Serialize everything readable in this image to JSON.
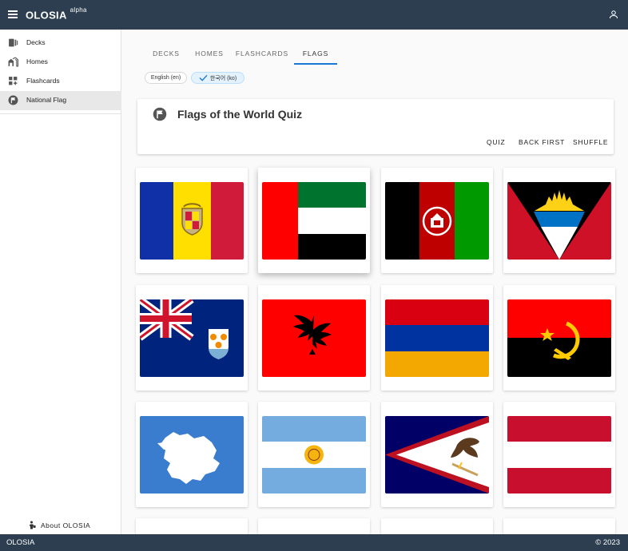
{
  "app": {
    "name": "OLOSIA",
    "stage": "alpha"
  },
  "sidebar": {
    "items": [
      {
        "label": "Decks",
        "icon": "deck-icon"
      },
      {
        "label": "Homes",
        "icon": "homes-icon"
      },
      {
        "label": "Flashcards",
        "icon": "flashcards-icon"
      },
      {
        "label": "National Flag",
        "icon": "flag-icon",
        "active": true
      }
    ],
    "about": "About OLOSIA"
  },
  "tabs": [
    {
      "label": "DECKS"
    },
    {
      "label": "HOMES"
    },
    {
      "label": "FLASHCARDS"
    },
    {
      "label": "FLAGS",
      "active": true
    }
  ],
  "chips": {
    "english": "English (en)",
    "korean": "한국어 (ko)",
    "selected": "korean"
  },
  "quiz": {
    "title": "Flags of the World Quiz",
    "actions": {
      "quiz": "QUIZ",
      "back_first": "BACK FIRST",
      "shuffle": "SHUFFLE"
    }
  },
  "flags": [
    {
      "name": "andorra"
    },
    {
      "name": "united-arab-emirates"
    },
    {
      "name": "afghanistan"
    },
    {
      "name": "antigua-and-barbuda"
    },
    {
      "name": "anguilla"
    },
    {
      "name": "albania"
    },
    {
      "name": "armenia"
    },
    {
      "name": "angola"
    },
    {
      "name": "antarctica"
    },
    {
      "name": "argentina"
    },
    {
      "name": "american-samoa"
    },
    {
      "name": "austria"
    }
  ],
  "colors": {
    "topbar": "#2c3e50",
    "accent": "#1976d2"
  },
  "footer": {
    "left": "OLOSIA",
    "right": "© 2023"
  }
}
